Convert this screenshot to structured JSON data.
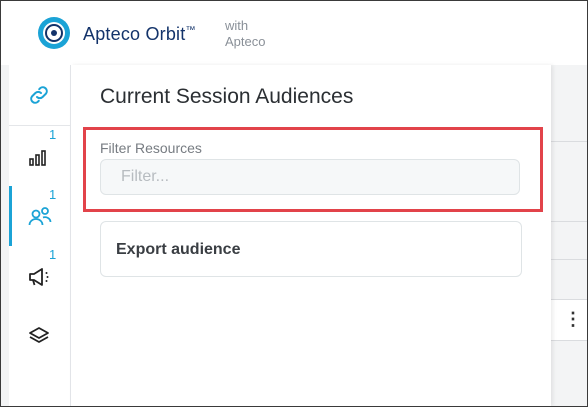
{
  "brand": {
    "name": "Apteco Orbit",
    "tm": "™",
    "with_line1": "with",
    "with_line2": "Apteco"
  },
  "sidenav": {
    "items": [
      {
        "icon": "link-icon",
        "badge": ""
      },
      {
        "icon": "bar-chart-icon",
        "badge": "1"
      },
      {
        "icon": "people-icon",
        "badge": "1",
        "active": true
      },
      {
        "icon": "megaphone-icon",
        "badge": "1"
      },
      {
        "icon": "layers-icon",
        "badge": ""
      }
    ]
  },
  "panel": {
    "title": "Current Session Audiences",
    "filter": {
      "label": "Filter Resources",
      "placeholder": "Filter...",
      "value": ""
    },
    "audiences": [
      {
        "label": "Export audience"
      }
    ]
  },
  "colors": {
    "accent": "#1ba3d6",
    "brand": "#13336a",
    "highlight": "#e2434a"
  }
}
